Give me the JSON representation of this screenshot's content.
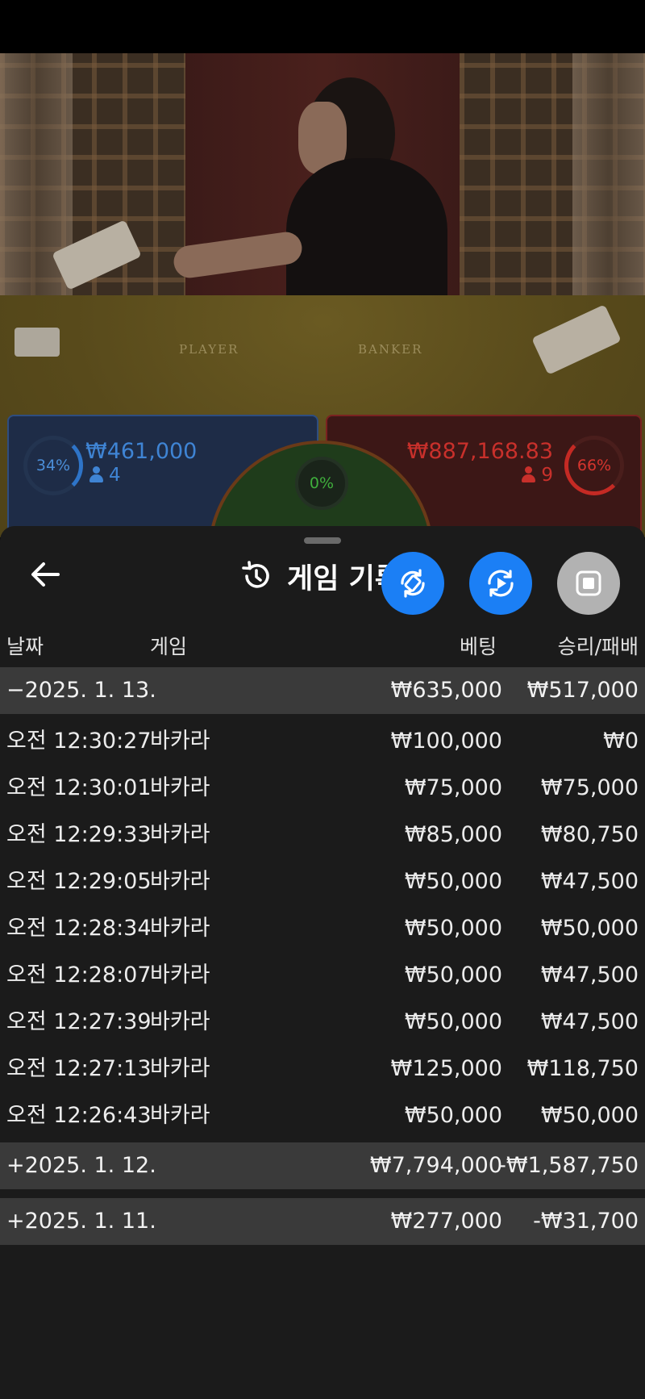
{
  "table": {
    "player_label": "PLAYER",
    "banker_label": "BANKER"
  },
  "bets": {
    "player": {
      "percent": "34%",
      "amount": "₩461,000",
      "count": "4",
      "color": "#3f84d4"
    },
    "tie": {
      "percent": "0%",
      "color": "#3fae3c"
    },
    "banker": {
      "percent": "66%",
      "amount": "₩887,168.83",
      "count": "9",
      "color": "#c8302b"
    }
  },
  "history": {
    "title": "게임 기록",
    "icons": {
      "back": "arrow-left-icon",
      "title": "history-icon",
      "fab1": "rotate-device-icon",
      "fab2": "replay-icon",
      "fab3": "stop-icon"
    },
    "columns": {
      "date": "날짜",
      "game": "게임",
      "bet": "베팅",
      "result": "승리/패배"
    },
    "groups": [
      {
        "date": "−2025. 1. 13.",
        "bet": "₩635,000",
        "result": "₩517,000",
        "rows": [
          {
            "time": "오전 12:30:27",
            "game": "바카라",
            "bet": "₩100,000",
            "result": "₩0"
          },
          {
            "time": "오전 12:30:01",
            "game": "바카라",
            "bet": "₩75,000",
            "result": "₩75,000"
          },
          {
            "time": "오전 12:29:33",
            "game": "바카라",
            "bet": "₩85,000",
            "result": "₩80,750"
          },
          {
            "time": "오전 12:29:05",
            "game": "바카라",
            "bet": "₩50,000",
            "result": "₩47,500"
          },
          {
            "time": "오전 12:28:34",
            "game": "바카라",
            "bet": "₩50,000",
            "result": "₩50,000"
          },
          {
            "time": "오전 12:28:07",
            "game": "바카라",
            "bet": "₩50,000",
            "result": "₩47,500"
          },
          {
            "time": "오전 12:27:39",
            "game": "바카라",
            "bet": "₩50,000",
            "result": "₩47,500"
          },
          {
            "time": "오전 12:27:13",
            "game": "바카라",
            "bet": "₩125,000",
            "result": "₩118,750"
          },
          {
            "time": "오전 12:26:43",
            "game": "바카라",
            "bet": "₩50,000",
            "result": "₩50,000"
          }
        ]
      },
      {
        "date": "+2025. 1. 12.",
        "bet": "₩7,794,000",
        "result": "-₩1,587,750"
      },
      {
        "date": "+2025. 1. 11.",
        "bet": "₩277,000",
        "result": "-₩31,700"
      }
    ]
  },
  "colors": {
    "sheet_bg": "#1b1b1b",
    "group_bg": "#3a3a3a",
    "fab_blue": "#1b7ff5",
    "fab_grey": "#b2b2b2"
  }
}
